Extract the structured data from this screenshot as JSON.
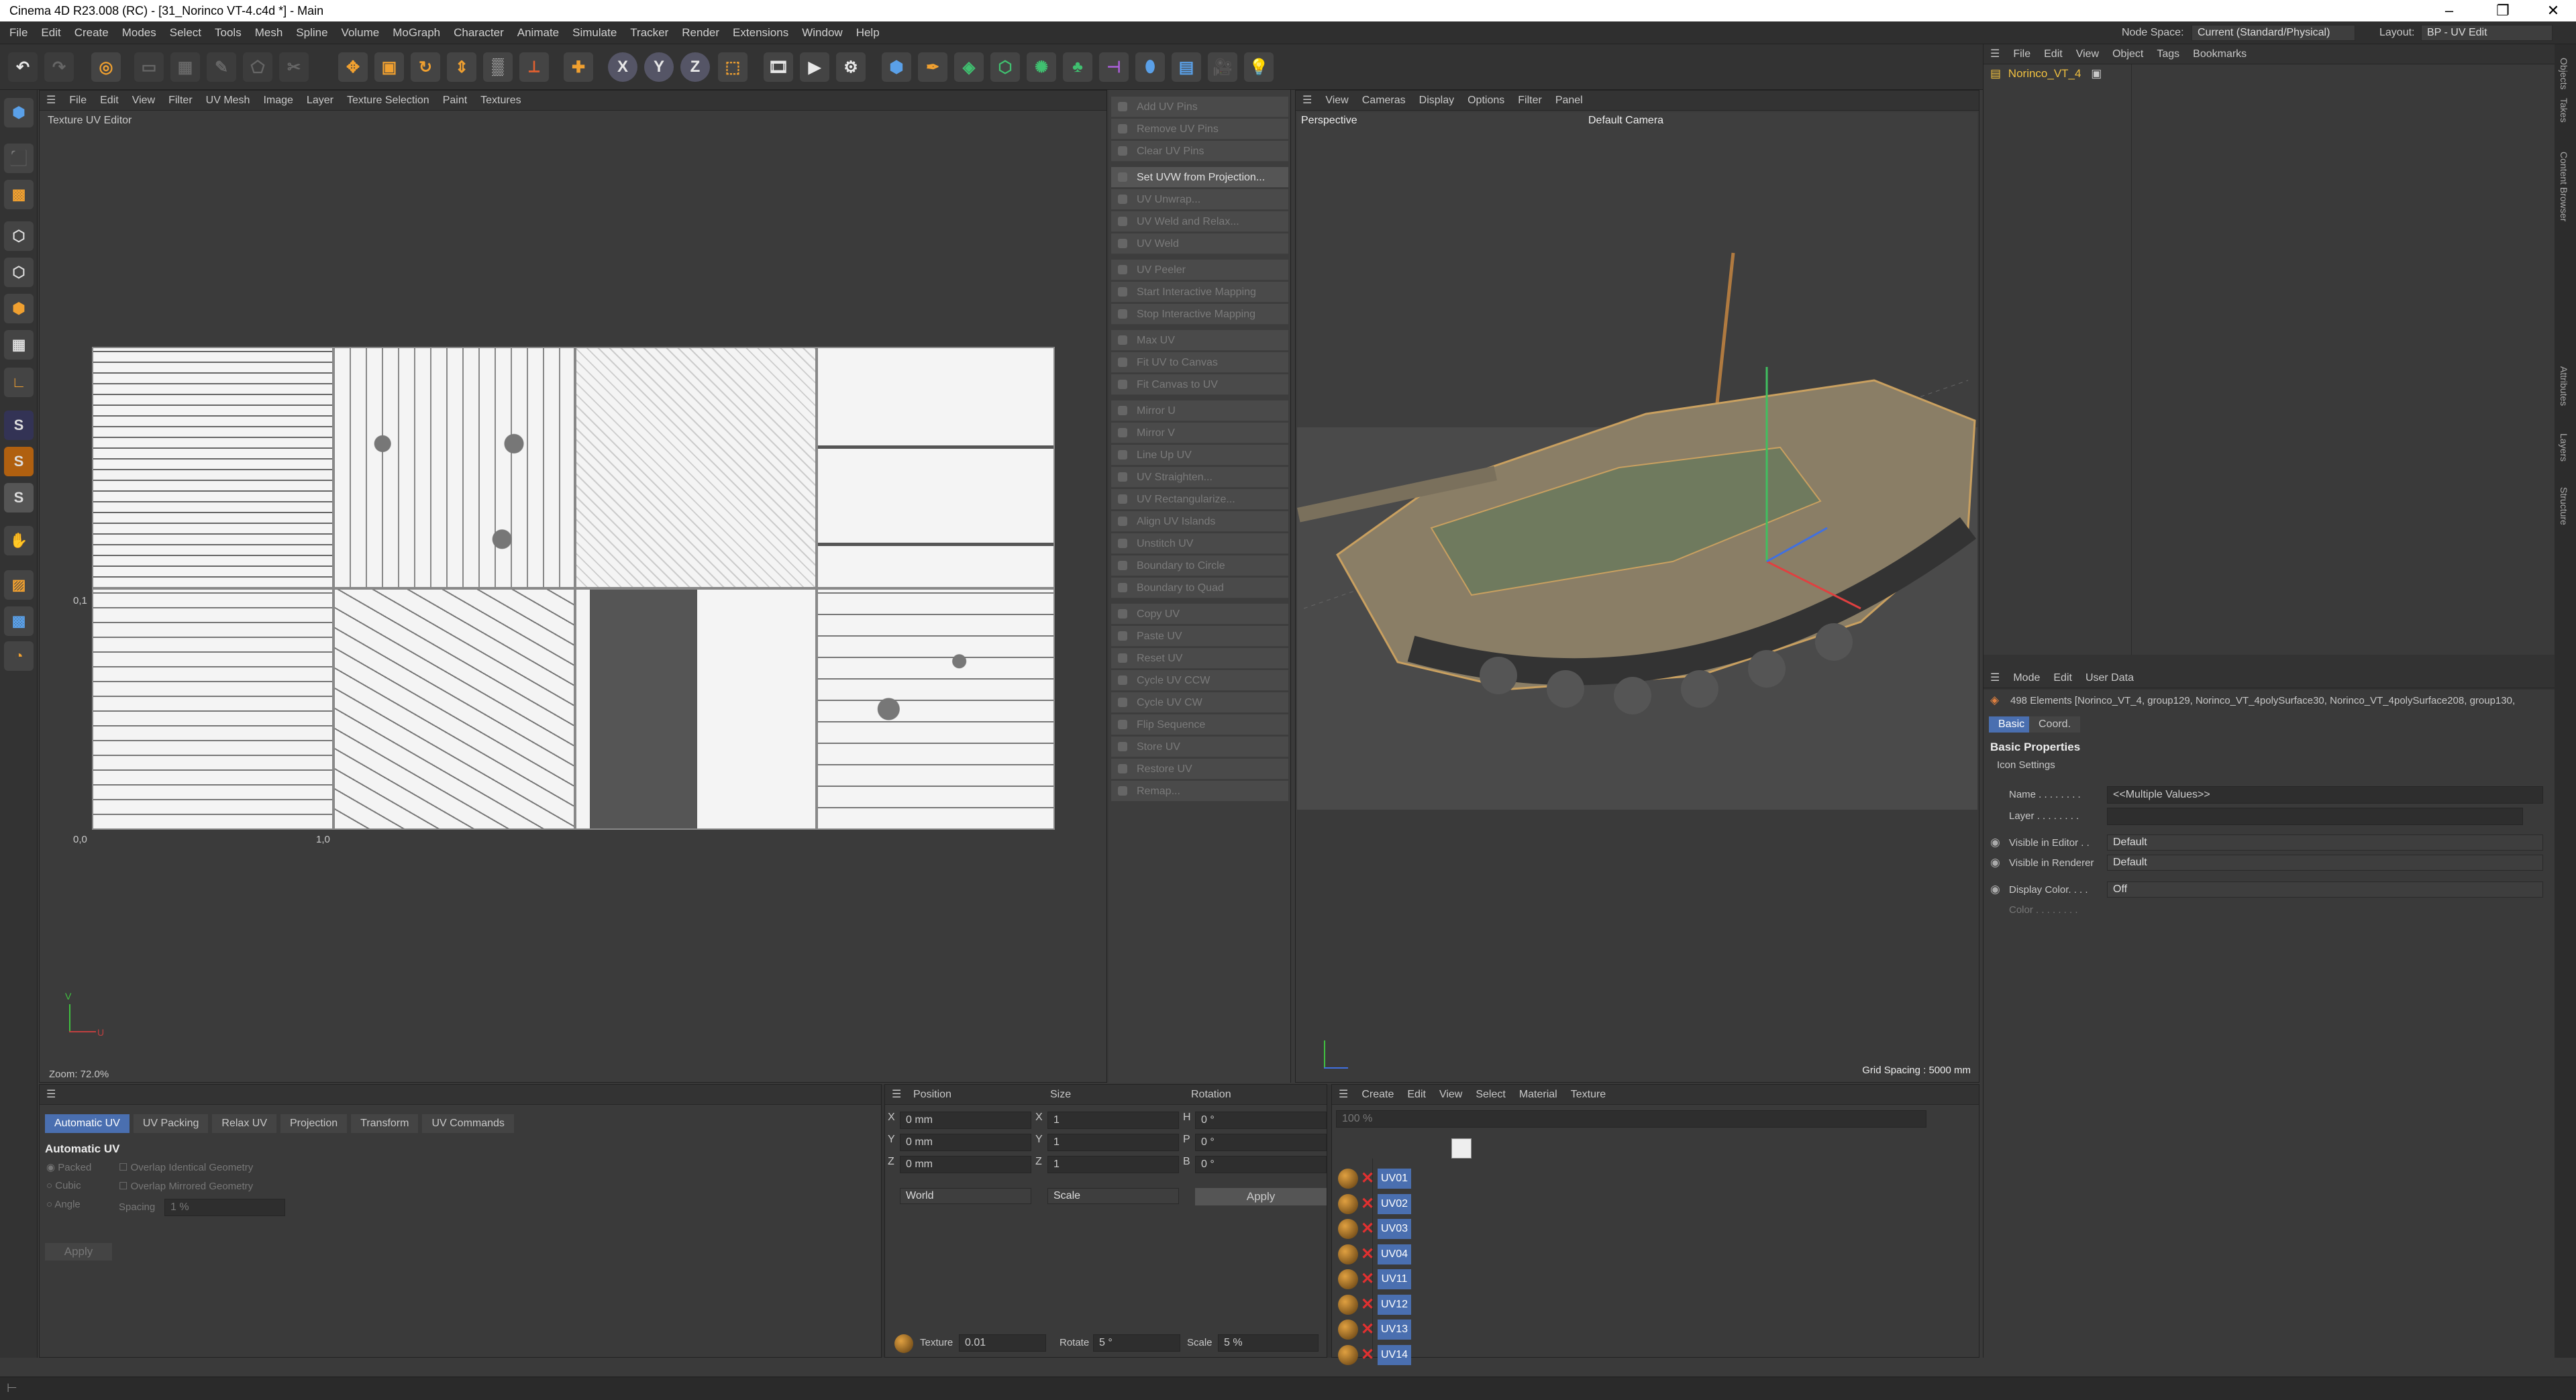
{
  "window": {
    "title": "Cinema 4D R23.008 (RC) - [31_Norinco VT-4.c4d *] - Main",
    "min": "–",
    "max": "❐",
    "close": "✕"
  },
  "menubar": {
    "items": [
      "File",
      "Edit",
      "Create",
      "Modes",
      "Select",
      "Tools",
      "Mesh",
      "Spline",
      "Volume",
      "MoGraph",
      "Character",
      "Animate",
      "Simulate",
      "Tracker",
      "Render",
      "Extensions",
      "Window",
      "Help"
    ],
    "node_space_label": "Node Space:",
    "node_space_value": "Current (Standard/Physical)",
    "layout_label": "Layout:",
    "layout_value": "BP - UV Edit"
  },
  "toolbar": {
    "x": "X",
    "y": "Y",
    "z": "Z"
  },
  "lefttools": {
    "s1": "S",
    "s2": "S",
    "s3": "S"
  },
  "uv_editor": {
    "menu": [
      "File",
      "Edit",
      "View",
      "Filter",
      "UV Mesh",
      "Image",
      "Layer",
      "Texture Selection",
      "Paint",
      "Textures"
    ],
    "title": "Texture UV Editor",
    "label_01": "0,1",
    "label_00": "0,0",
    "label_10": "1,0",
    "zoom": "Zoom: 72.0%",
    "axis_v": "V",
    "axis_u": "U"
  },
  "uv_commands": {
    "items": [
      "Add UV Pins",
      "Remove UV Pins",
      "Clear UV Pins",
      "Set UVW from Projection...",
      "UV Unwrap...",
      "UV Weld and Relax...",
      "UV Weld",
      "UV Peeler",
      "Start Interactive Mapping",
      "Stop Interactive Mapping",
      "Max UV",
      "Fit UV to Canvas",
      "Fit Canvas to UV",
      "Mirror U",
      "Mirror V",
      "Line Up UV",
      "UV Straighten...",
      "UV Rectangularize...",
      "Align UV Islands",
      "Unstitch UV",
      "Boundary to Circle",
      "Boundary to Quad",
      "Copy UV",
      "Paste UV",
      "Reset UV",
      "Cycle UV CCW",
      "Cycle UV CW",
      "Flip Sequence",
      "Store UV",
      "Restore UV",
      "Remap..."
    ]
  },
  "viewport": {
    "menu": [
      "View",
      "Cameras",
      "Display",
      "Options",
      "Filter",
      "Panel"
    ],
    "view_name": "Perspective",
    "camera": "Default Camera",
    "grid_spacing": "Grid Spacing : 5000 mm"
  },
  "objects": {
    "menu": [
      "File",
      "Edit",
      "View",
      "Object",
      "Tags",
      "Bookmarks"
    ],
    "item": "Norinco_VT_4"
  },
  "attributes": {
    "menu": [
      "Mode",
      "Edit",
      "User Data"
    ],
    "selection": "498 Elements [Norinco_VT_4, group129, Norinco_VT_4polySurface30, Norinco_VT_4polySurface208, group130,",
    "tab_basic": "Basic",
    "tab_coord": "Coord.",
    "section": "Basic Properties",
    "icon_settings": "Icon Settings",
    "name_label": "Name . . . . . . . .",
    "name_value": "<<Multiple Values>>",
    "layer_label": "Layer . . . . . . . .",
    "vis_editor_label": "Visible in Editor . .",
    "vis_editor_value": "Default",
    "vis_render_label": "Visible in Renderer",
    "vis_render_value": "Default",
    "display_color_label": "Display Color. . . .",
    "display_color_value": "Off",
    "color_label": "Color . . . . . . . ."
  },
  "right_strip": [
    "Objects",
    "Takes",
    "Content Browser",
    "Attributes",
    "Layers",
    "Structure"
  ],
  "uv_manager": {
    "tabs": [
      "Automatic UV",
      "UV Packing",
      "Relax UV",
      "Projection",
      "Transform",
      "UV Commands"
    ],
    "section": "Automatic UV",
    "opt_packed": "Packed",
    "opt_cubic": "Cubic",
    "opt_angle": "Angle",
    "chk_overlap_identical": "Overlap Identical Geometry",
    "chk_overlap_mirrored": "Overlap Mirrored Geometry",
    "spacing_label": "Spacing",
    "spacing_value": "1 %",
    "apply": "Apply"
  },
  "coords": {
    "h_position": "Position",
    "h_size": "Size",
    "h_rotation": "Rotation",
    "rows": [
      {
        "axis": "X",
        "pos": "0 mm",
        "saxis": "X",
        "size": "1",
        "raxis": "H",
        "rot": "0 °"
      },
      {
        "axis": "Y",
        "pos": "0 mm",
        "saxis": "Y",
        "size": "1",
        "raxis": "P",
        "rot": "0 °"
      },
      {
        "axis": "Z",
        "pos": "0 mm",
        "saxis": "Z",
        "size": "1",
        "raxis": "B",
        "rot": "0 °"
      }
    ],
    "world": "World",
    "scale": "Scale",
    "apply": "Apply",
    "texture_label": "Texture",
    "texture_value": "0.01",
    "rotate_label": "Rotate",
    "rotate_value": "5 °",
    "scale_label": "Scale",
    "scale_value": "5 %"
  },
  "materials": {
    "menu": [
      "Create",
      "Edit",
      "View",
      "Select",
      "Material",
      "Texture"
    ],
    "zoom": "100 %",
    "uv_tags": [
      "UV01",
      "UV02",
      "UV03",
      "UV04",
      "UV11",
      "UV12",
      "UV13",
      "UV14"
    ]
  }
}
